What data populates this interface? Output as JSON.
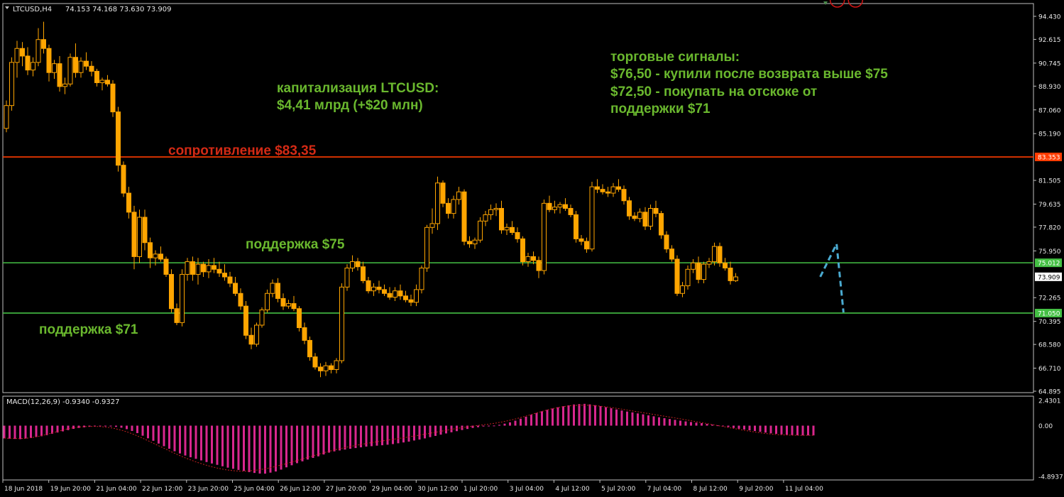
{
  "header": {
    "symbol": "LTCUSD,H4",
    "ohlc": "74.153 74.168 73.630 73.909"
  },
  "macd_label": "MACD(12,26,9) -0.9340 -0.9327",
  "annotations": {
    "cap_line1": "капитализация LTCUSD:",
    "cap_line2": "$4,41 млрд (+$20 млн)",
    "signals_title": "торговые сигналы:",
    "signal_1": "$76,50 - купили после возврата выше $75",
    "signal_2a": "$72,50 - покупать на отскоке от",
    "signal_2b": "поддержки $71",
    "resistance_label": "сопротивление $83,35",
    "support75_label": "поддержка $75",
    "support71_label": "поддержка $71"
  },
  "colors": {
    "background": "#000000",
    "candle": "#ffa500",
    "grid_frame": "#c0c0c0",
    "resistance": "#ff3c00",
    "support": "#44c044",
    "annotation_green": "#6ab82e",
    "annotation_red": "#d42a15",
    "macd_hist": "#d8278e",
    "macd_signal": "#c02020",
    "forecast": "#4aaad0",
    "target_circle": "#d01515"
  },
  "chart_data": {
    "type": "candlestick",
    "price_axis": {
      "ticks": [
        "94.430",
        "92.615",
        "90.745",
        "88.930",
        "87.060",
        "85.190",
        "83.353",
        "81.505",
        "79.635",
        "77.820",
        "75.950",
        "75.012",
        "73.909",
        "72.265",
        "71.050",
        "70.395",
        "68.580",
        "66.710",
        "64.895"
      ],
      "range": [
        64.895,
        94.43
      ]
    },
    "levels": [
      {
        "price": 83.353,
        "label": "83.353",
        "role": "resistance"
      },
      {
        "price": 75.012,
        "label": "75.012",
        "role": "support"
      },
      {
        "price": 71.05,
        "label": "71.050",
        "role": "support"
      }
    ],
    "current_price": {
      "price": 73.909,
      "label": "73.909"
    },
    "time_labels": [
      "18 Jun 2018",
      "19 Jun 20:00",
      "21 Jun 04:00",
      "22 Jun 12:00",
      "23 Jun 20:00",
      "25 Jun 04:00",
      "26 Jun 12:00",
      "27 Jun 20:00",
      "29 Jun 04:00",
      "30 Jun 12:00",
      "1 Jul 20:00",
      "3 Jul 04:00",
      "4 Jul 12:00",
      "5 Jul 20:00",
      "7 Jul 04:00",
      "8 Jul 12:00",
      "9 Jul 20:00",
      "11 Jul 04:00"
    ],
    "candles": [
      [
        85.6,
        87.8,
        85.3,
        87.4
      ],
      [
        87.4,
        91.2,
        87,
        90.8
      ],
      [
        90.8,
        92.5,
        89.6,
        91.9
      ],
      [
        91.9,
        92.4,
        90.5,
        91.3
      ],
      [
        91.3,
        92,
        89.8,
        90.2
      ],
      [
        90.2,
        91.2,
        89.7,
        90.8
      ],
      [
        90.8,
        93.5,
        90.5,
        92.6
      ],
      [
        92.6,
        94,
        91.5,
        91.9
      ],
      [
        91.9,
        92.2,
        89.3,
        90
      ],
      [
        90,
        91,
        89.5,
        90.7
      ],
      [
        90.7,
        91.3,
        88.5,
        88.9
      ],
      [
        88.9,
        89.6,
        88.3,
        89.1
      ],
      [
        89.1,
        91.5,
        88.9,
        91.2
      ],
      [
        91.2,
        92.3,
        89.6,
        90
      ],
      [
        90,
        91.2,
        89.6,
        90.9
      ],
      [
        90.9,
        91.6,
        90.2,
        90.5
      ],
      [
        90.5,
        90.9,
        89.7,
        90.1
      ],
      [
        90.1,
        90.3,
        88.9,
        89.2
      ],
      [
        89.2,
        89.6,
        88.6,
        89.4
      ],
      [
        89.4,
        89.8,
        88.9,
        89.1
      ],
      [
        89.1,
        89.4,
        86.5,
        86.9
      ],
      [
        86.9,
        87.3,
        82.2,
        82.7
      ],
      [
        82.7,
        83,
        80.2,
        80.5
      ],
      [
        80.5,
        81,
        78.5,
        79
      ],
      [
        79,
        79.5,
        74.5,
        75.5
      ],
      [
        75.5,
        79.2,
        75,
        78.6
      ],
      [
        78.6,
        79.2,
        76,
        76.6
      ],
      [
        76.6,
        77,
        74.6,
        75.4
      ],
      [
        75.4,
        76,
        74.8,
        75.7
      ],
      [
        75.7,
        76.3,
        75.1,
        75.3
      ],
      [
        75.3,
        75.5,
        73.9,
        74.1
      ],
      [
        74.1,
        74.5,
        71.1,
        71.4
      ],
      [
        71.4,
        71.8,
        70.1,
        70.3
      ],
      [
        70.3,
        74.5,
        70,
        74.1
      ],
      [
        74.1,
        75.4,
        73.6,
        75.1
      ],
      [
        75.1,
        75.5,
        73.6,
        74.1
      ],
      [
        74.1,
        75.4,
        73.3,
        74.9
      ],
      [
        74.9,
        75.1,
        73.9,
        74.3
      ],
      [
        74.3,
        75.3,
        73.8,
        74.8
      ],
      [
        74.8,
        75.4,
        74.2,
        74.5
      ],
      [
        74.5,
        75.1,
        73.9,
        74.2
      ],
      [
        74.2,
        74.9,
        73.6,
        73.9
      ],
      [
        73.9,
        74.3,
        73.1,
        73.4
      ],
      [
        73.4,
        73.9,
        72.4,
        72.6
      ],
      [
        72.6,
        73,
        71.3,
        71.6
      ],
      [
        71.6,
        72,
        69,
        69.3
      ],
      [
        69.3,
        69.9,
        68.2,
        68.6
      ],
      [
        68.6,
        70.3,
        68.4,
        70.1
      ],
      [
        70.1,
        71.5,
        69.9,
        71.3
      ],
      [
        71.3,
        72.9,
        71.1,
        72.6
      ],
      [
        72.6,
        73.7,
        72.3,
        73.4
      ],
      [
        73.4,
        73.8,
        71.9,
        72.2
      ],
      [
        72.2,
        72.6,
        71.3,
        71.6
      ],
      [
        71.6,
        72.1,
        71.4,
        71.8
      ],
      [
        71.8,
        72.4,
        71.2,
        71.4
      ],
      [
        71.4,
        71.6,
        69.6,
        69.9
      ],
      [
        69.9,
        70.3,
        68.6,
        68.9
      ],
      [
        68.9,
        69.2,
        67.3,
        67.6
      ],
      [
        67.6,
        67.9,
        66.6,
        66.8
      ],
      [
        66.8,
        67.1,
        66,
        66.5
      ],
      [
        66.5,
        67.2,
        66.1,
        66.9
      ],
      [
        66.9,
        67.1,
        66.3,
        66.6
      ],
      [
        66.6,
        67.5,
        66.3,
        67.3
      ],
      [
        67.3,
        73.4,
        67.1,
        73.1
      ],
      [
        73.1,
        74.9,
        72.8,
        74.6
      ],
      [
        74.6,
        75.6,
        74.3,
        75.1
      ],
      [
        75.1,
        75.4,
        74.4,
        74.7
      ],
      [
        74.7,
        75.1,
        73.4,
        73.6
      ],
      [
        73.6,
        73.9,
        72.6,
        72.8
      ],
      [
        72.8,
        73.4,
        72.4,
        73.1
      ],
      [
        73.1,
        73.6,
        72.6,
        72.9
      ],
      [
        72.9,
        73.3,
        72.4,
        72.6
      ],
      [
        72.6,
        73.1,
        72.1,
        72.3
      ],
      [
        72.3,
        73.1,
        72,
        72.8
      ],
      [
        72.8,
        73.3,
        72.1,
        72.4
      ],
      [
        72.4,
        72.8,
        71.9,
        72.1
      ],
      [
        72.1,
        72.5,
        71.6,
        71.9
      ],
      [
        71.9,
        73.3,
        71.6,
        72.9
      ],
      [
        72.9,
        74.8,
        72.6,
        74.6
      ],
      [
        74.6,
        78,
        74.3,
        77.8
      ],
      [
        77.8,
        79.3,
        77.3,
        78.1
      ],
      [
        78.1,
        81.8,
        77.6,
        81.3
      ],
      [
        81.3,
        81.5,
        79.4,
        79.7
      ],
      [
        79.7,
        80.1,
        78.5,
        78.9
      ],
      [
        78.9,
        80.3,
        78.5,
        80
      ],
      [
        80,
        81,
        79.6,
        80.6
      ],
      [
        80.6,
        80.8,
        76.4,
        76.7
      ],
      [
        76.7,
        77.1,
        76.2,
        76.5
      ],
      [
        76.5,
        77,
        76.1,
        76.8
      ],
      [
        76.8,
        78.6,
        76.6,
        78.3
      ],
      [
        78.3,
        79.1,
        77.9,
        78.8
      ],
      [
        78.8,
        79.6,
        78.4,
        79.2
      ],
      [
        79.2,
        79.7,
        78.7,
        79.3
      ],
      [
        79.3,
        79.9,
        77.3,
        77.6
      ],
      [
        77.6,
        78.1,
        77.2,
        77.8
      ],
      [
        77.8,
        78.3,
        77.2,
        77.4
      ],
      [
        77.4,
        77.8,
        76.6,
        76.9
      ],
      [
        76.9,
        77.1,
        74.8,
        75.1
      ],
      [
        75.1,
        75.8,
        74.7,
        75.5
      ],
      [
        75.5,
        75.9,
        74.9,
        75.2
      ],
      [
        75.2,
        75.5,
        73.8,
        74.4
      ],
      [
        74.4,
        80,
        74.1,
        79.7
      ],
      [
        79.7,
        80.3,
        79,
        79.2
      ],
      [
        79.2,
        79.9,
        78.9,
        79.4
      ],
      [
        79.4,
        79.8,
        78.9,
        79.6
      ],
      [
        79.6,
        80.1,
        79.1,
        79.3
      ],
      [
        79.3,
        79.6,
        78.6,
        78.8
      ],
      [
        78.8,
        79.1,
        76.6,
        76.9
      ],
      [
        76.9,
        77.2,
        76.4,
        76.7
      ],
      [
        76.7,
        77,
        75.8,
        76.1
      ],
      [
        76.1,
        81.4,
        75.9,
        81
      ],
      [
        81,
        81.6,
        80.5,
        80.8
      ],
      [
        80.8,
        81.2,
        80.4,
        80.6
      ],
      [
        80.6,
        81,
        80.2,
        80.5
      ],
      [
        80.5,
        81.3,
        80.2,
        81
      ],
      [
        81,
        81.6,
        80.6,
        80.8
      ],
      [
        80.8,
        81.1,
        79.6,
        79.9
      ],
      [
        79.9,
        80.2,
        78.4,
        78.7
      ],
      [
        78.7,
        79,
        78.3,
        78.5
      ],
      [
        78.5,
        79.3,
        78.2,
        79
      ],
      [
        79,
        79.4,
        77.6,
        77.9
      ],
      [
        77.9,
        79.6,
        77.6,
        79.3
      ],
      [
        79.3,
        79.9,
        78.6,
        78.9
      ],
      [
        78.9,
        79.1,
        76.9,
        77.2
      ],
      [
        77.2,
        77.5,
        75.8,
        76.1
      ],
      [
        76.1,
        76.4,
        75.1,
        75.3
      ],
      [
        75.3,
        75.6,
        72.4,
        72.6
      ],
      [
        72.6,
        73.5,
        72.3,
        73.2
      ],
      [
        73.2,
        74.8,
        72.9,
        74.5
      ],
      [
        74.5,
        75.3,
        74.2,
        75
      ],
      [
        75,
        75.5,
        73.4,
        73.7
      ],
      [
        73.7,
        75.1,
        73.4,
        74.9
      ],
      [
        74.9,
        75.4,
        74.6,
        75.1
      ],
      [
        75.1,
        76.6,
        74.8,
        76.3
      ],
      [
        76.3,
        76.6,
        74.7,
        75
      ],
      [
        75,
        75.4,
        74.4,
        74.6
      ],
      [
        74.6,
        75.1,
        73.3,
        73.6
      ],
      [
        73.6,
        74.2,
        73.5,
        73.9
      ]
    ],
    "macd": {
      "label": "MACD(12,26,9) -0.9340 -0.9327",
      "axis_ticks": [
        "2.4301",
        "0.00",
        "-4.8937"
      ],
      "range": [
        -4.8937,
        2.4301
      ],
      "histogram": [
        -1.23,
        -1.25,
        -1.28,
        -1.3,
        -1.24,
        -1.19,
        -1.1,
        -1.02,
        -0.92,
        -0.78,
        -0.66,
        -0.55,
        -0.43,
        -0.31,
        -0.22,
        -0.16,
        -0.11,
        -0.08,
        -0.07,
        -0.06,
        -0.08,
        -0.12,
        -0.2,
        -0.34,
        -0.51,
        -0.72,
        -0.97,
        -1.22,
        -1.46,
        -1.73,
        -1.98,
        -2.23,
        -2.47,
        -2.68,
        -2.88,
        -3.05,
        -3.2,
        -3.35,
        -3.51,
        -3.65,
        -3.78,
        -3.92,
        -4.05,
        -4.16,
        -4.27,
        -4.37,
        -4.48,
        -4.56,
        -4.62,
        -4.63,
        -4.53,
        -4.42,
        -4.24,
        -4.02,
        -3.82,
        -3.62,
        -3.44,
        -3.27,
        -3.11,
        -2.96,
        -2.78,
        -2.6,
        -2.48,
        -2.39,
        -2.31,
        -2.23,
        -2.16,
        -2.09,
        -2.02,
        -1.98,
        -1.93,
        -1.89,
        -1.84,
        -1.78,
        -1.7,
        -1.62,
        -1.54,
        -1.43,
        -1.34,
        -1.23,
        -1.11,
        -0.99,
        -0.87,
        -0.75,
        -0.64,
        -0.53,
        -0.42,
        -0.32,
        -0.22,
        -0.15,
        -0.08,
        -0.03,
        0.01,
        0.08,
        0.19,
        0.32,
        0.48,
        0.67,
        0.86,
        1.05,
        1.22,
        1.38,
        1.52,
        1.65,
        1.77,
        1.87,
        1.96,
        2.04,
        2.08,
        2.1,
        2.05,
        1.97,
        1.88,
        1.78,
        1.68,
        1.56,
        1.46,
        1.36,
        1.28,
        1.18,
        1.09,
        0.99,
        0.9,
        0.81,
        0.72,
        0.64,
        0.56,
        0.48,
        0.41,
        0.35,
        0.29,
        0.24,
        0.17,
        0.1,
        0.03,
        -0.05,
        -0.13,
        -0.22,
        -0.3,
        -0.37,
        -0.45,
        -0.52,
        -0.6,
        -0.67,
        -0.74,
        -0.79,
        -0.84,
        -0.88,
        -0.91,
        -0.93,
        -0.94,
        -0.94,
        -0.94
      ],
      "signal": [
        -1.2,
        -1.22,
        -1.24,
        -1.23,
        -1.15,
        -1.02,
        -0.86,
        -0.69,
        -0.51,
        -0.33,
        -0.2,
        -0.12,
        -0.08,
        -0.07,
        -0.09,
        -0.16,
        -0.28,
        -0.45,
        -0.66,
        -0.92,
        -1.21,
        -1.52,
        -1.84,
        -2.15,
        -2.47,
        -2.78,
        -3.06,
        -3.32,
        -3.56,
        -3.77,
        -3.96,
        -4.12,
        -4.25,
        -4.34,
        -4.38,
        -4.38,
        -4.33,
        -4.24,
        -4.12,
        -3.97,
        -3.8,
        -3.62,
        -3.43,
        -3.23,
        -3.03,
        -2.84,
        -2.65,
        -2.47,
        -2.3,
        -2.15,
        -2.01,
        -1.88,
        -1.76,
        -1.65,
        -1.54,
        -1.44,
        -1.34,
        -1.24,
        -1.14,
        -1.03,
        -0.92,
        -0.8,
        -0.68,
        -0.56,
        -0.44,
        -0.32,
        -0.21,
        -0.11,
        -0.02,
        0.06,
        0.14,
        0.24,
        0.36,
        0.5,
        0.66,
        0.84,
        1.03,
        1.23,
        1.42,
        1.6,
        1.74,
        1.85,
        1.93,
        1.97,
        1.98,
        1.95,
        1.89,
        1.81,
        1.72,
        1.62,
        1.51,
        1.4,
        1.29,
        1.18,
        1.07,
        0.96,
        0.85,
        0.74,
        0.63,
        0.51,
        0.39,
        0.27,
        0.15,
        0.03,
        -0.09,
        -0.21,
        -0.33,
        -0.45,
        -0.56,
        -0.66,
        -0.75,
        -0.82,
        -0.87,
        -0.9,
        -0.92,
        -0.93,
        -0.93,
        -0.93
      ]
    },
    "forecast_path": [
      {
        "x_pct": 0.7703,
        "y": 73.909
      },
      {
        "x_pct": 0.7857,
        "y": 76.5
      },
      {
        "x_pct": 0.7922,
        "y": 71.1
      },
      {
        "x_pct": 0.8035,
        "y": 72.0
      }
    ]
  }
}
